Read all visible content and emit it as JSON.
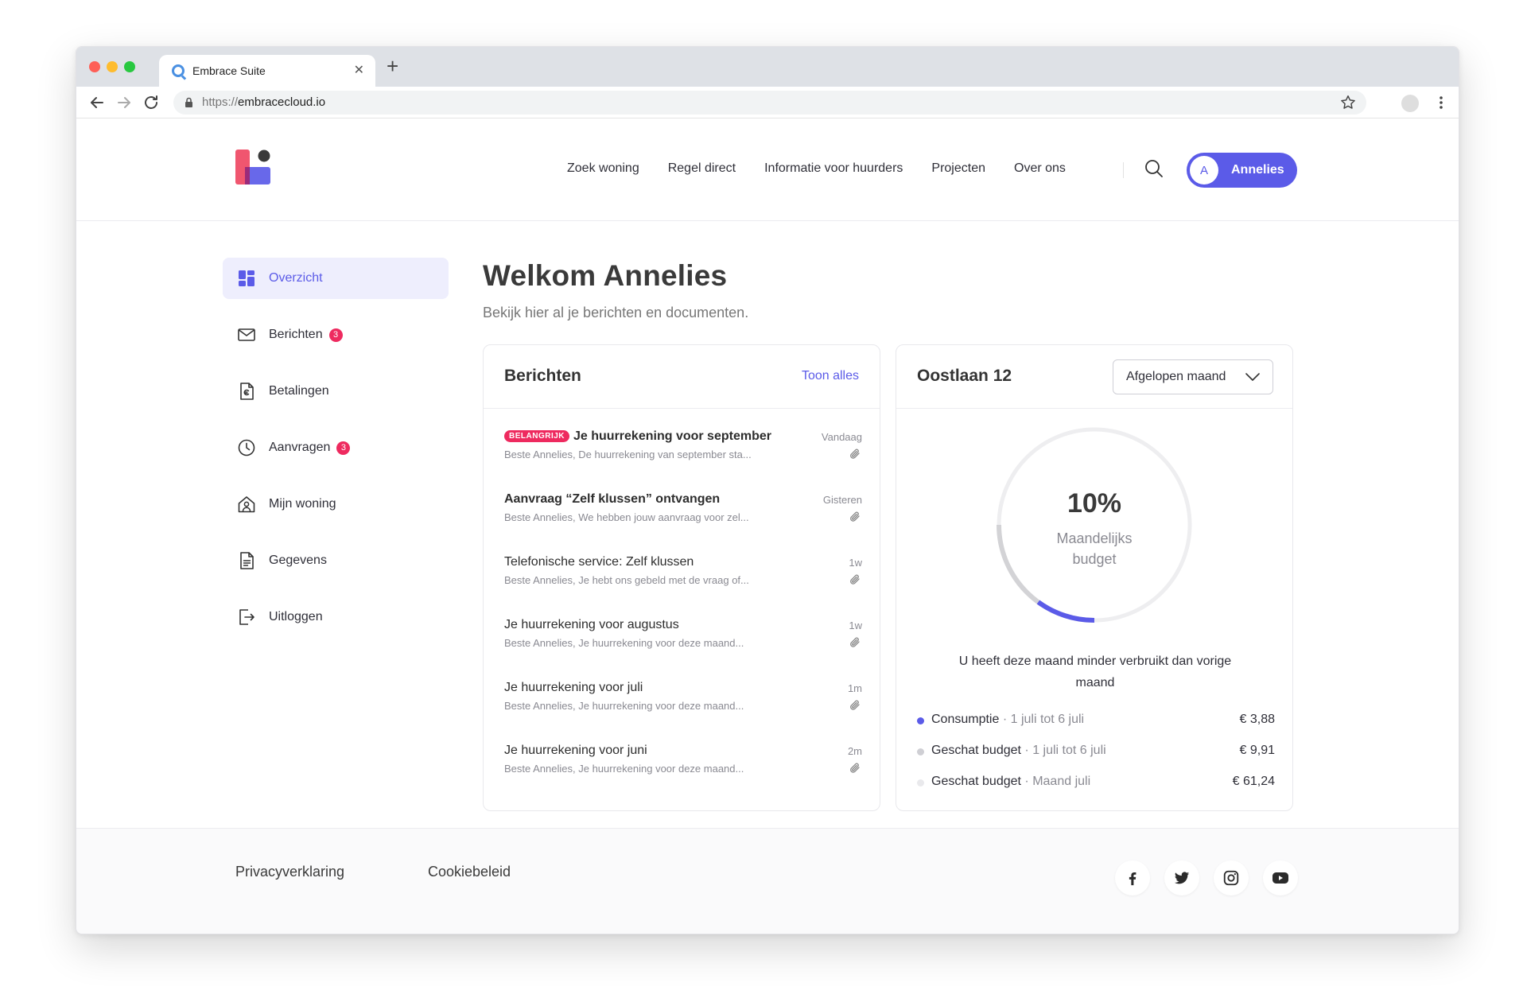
{
  "browser": {
    "tab_title": "Embrace Suite",
    "url_protocol": "https://",
    "url_host": "embracecloud.io"
  },
  "header": {
    "nav": [
      "Zoek woning",
      "Regel direct",
      "Informatie voor huurders",
      "Projecten",
      "Over ons"
    ],
    "user_initial": "A",
    "user_name": "Annelies"
  },
  "sidebar": {
    "items": [
      {
        "label": "Overzicht",
        "icon": "dashboard-icon",
        "active": true
      },
      {
        "label": "Berichten",
        "icon": "mail-icon",
        "badge": "3"
      },
      {
        "label": "Betalingen",
        "icon": "payment-document-icon"
      },
      {
        "label": "Aanvragen",
        "icon": "clock-icon",
        "badge": "3"
      },
      {
        "label": "Mijn woning",
        "icon": "home-icon"
      },
      {
        "label": "Gegevens",
        "icon": "document-icon"
      },
      {
        "label": "Uitloggen",
        "icon": "logout-icon"
      }
    ]
  },
  "main": {
    "title": "Welkom Annelies",
    "subtitle": "Bekijk hier al je berichten en documenten."
  },
  "messages": {
    "title": "Berichten",
    "show_all": "Toon alles",
    "items": [
      {
        "tag": "BELANGRIJK",
        "title": "Je huurrekening voor september",
        "preview": "Beste Annelies, De huurrekening van september sta...",
        "time": "Vandaag",
        "bold": true
      },
      {
        "title": "Aanvraag “Zelf klussen” ontvangen",
        "preview": "Beste Annelies, We hebben jouw aanvraag voor zel...",
        "time": "Gisteren",
        "bold": true
      },
      {
        "title": "Telefonische service: Zelf klussen",
        "preview": "Beste Annelies, Je hebt ons gebeld met de vraag of...",
        "time": "1w"
      },
      {
        "title": "Je huurrekening voor augustus",
        "preview": "Beste Annelies, Je huurrekening voor deze maand...",
        "time": "1w"
      },
      {
        "title": "Je huurrekening voor juli",
        "preview": "Beste Annelies, Je huurrekening voor deze maand...",
        "time": "1m"
      },
      {
        "title": "Je huurrekening voor juni",
        "preview": "Beste Annelies, Je huurrekening voor deze maand...",
        "time": "2m"
      }
    ]
  },
  "budget": {
    "title": "Oostlaan 12",
    "period": "Afgelopen maand",
    "percent_value": 10,
    "percent": "10%",
    "label_line1": "Maandelijks",
    "label_line2": "budget",
    "note": "U heeft deze maand minder verbruikt dan vorige maand",
    "accent": "#5b5be8",
    "items": [
      {
        "label": "Consumptie",
        "sub": "· 1 juli tot 6 juli",
        "amount": "€ 3,88",
        "color": "#5b5be8"
      },
      {
        "label": "Geschat budget",
        "sub": "· 1 juli tot 6 juli",
        "amount": "€ 9,91",
        "color": "#cfcfd4"
      },
      {
        "label": "Geschat budget",
        "sub": "· Maand juli",
        "amount": "€ 61,24",
        "color": "#e9e9ec"
      }
    ]
  },
  "footer": {
    "links": [
      "Privacyverklaring",
      "Cookiebeleid"
    ],
    "social": [
      "facebook-icon",
      "twitter-icon",
      "instagram-icon",
      "youtube-icon"
    ]
  },
  "colors": {
    "brand": "#5b5be8",
    "badge": "#ee2a5f",
    "logo_red": "#f0566f",
    "logo_dark": "#3a3a3a"
  }
}
